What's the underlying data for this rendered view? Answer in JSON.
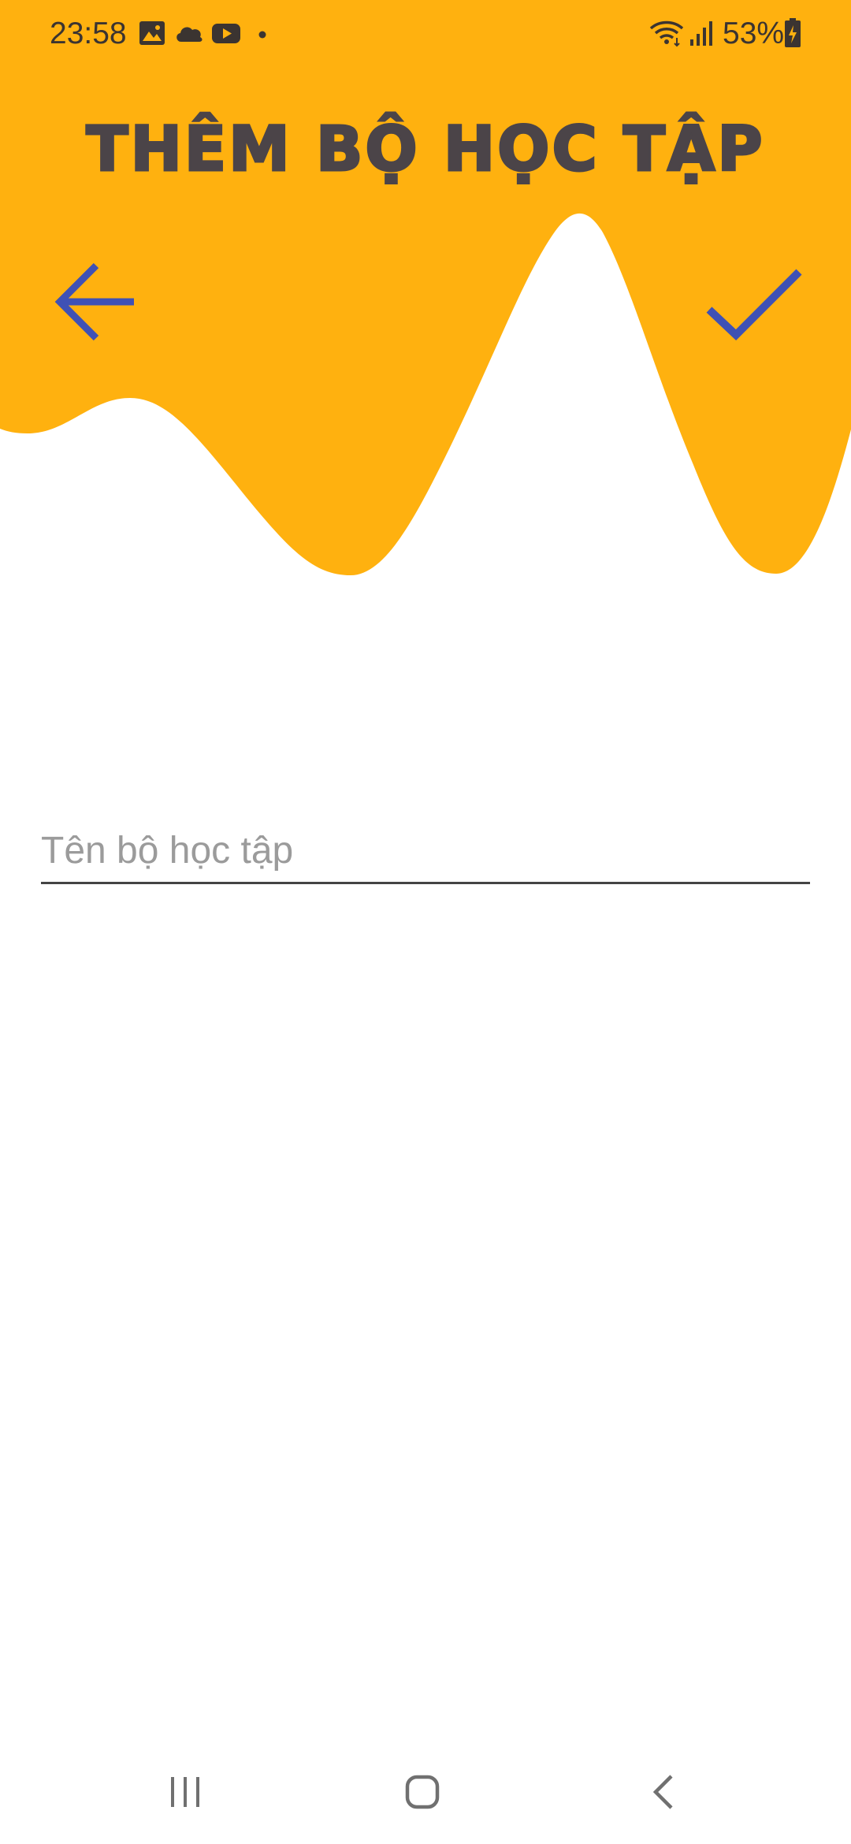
{
  "status_bar": {
    "time": "23:58",
    "notification_icons": [
      "gallery-icon",
      "cloud-icon",
      "youtube-icon",
      "dot-icon"
    ],
    "system_icons": [
      "wifi-icon",
      "signal-icon",
      "battery-charging-icon"
    ],
    "battery": "53%"
  },
  "header": {
    "title": "THÊM BỘ HỌC TẬP",
    "background_color": "#FFB10F",
    "icon_color": "#3F51B5",
    "back_icon": "arrow-left-icon",
    "confirm_icon": "check-icon"
  },
  "form": {
    "name_value": "",
    "name_placeholder": "Tên bộ học tập"
  },
  "nav_bar": {
    "buttons": [
      "recents-icon",
      "home-icon",
      "back-chevron-icon"
    ]
  }
}
